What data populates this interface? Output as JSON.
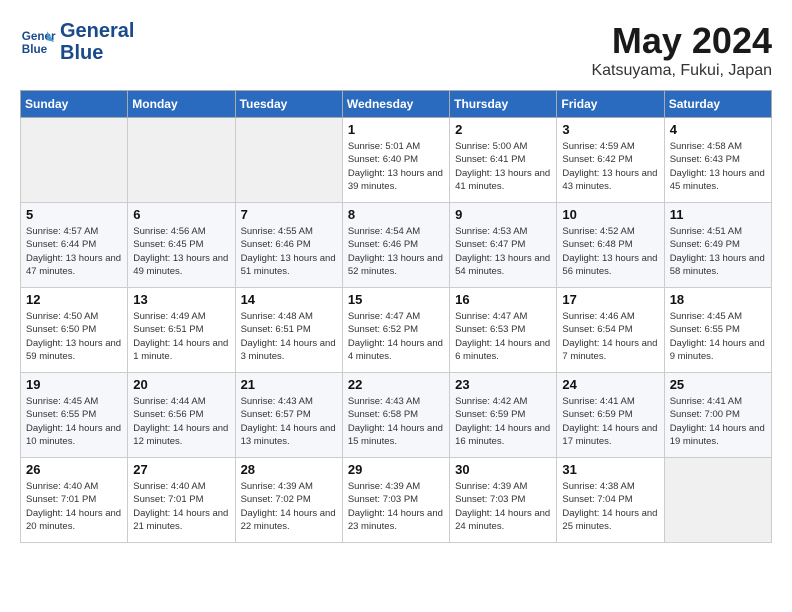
{
  "header": {
    "logo_line1": "General",
    "logo_line2": "Blue",
    "title": "May 2024",
    "subtitle": "Katsuyama, Fukui, Japan"
  },
  "weekdays": [
    "Sunday",
    "Monday",
    "Tuesday",
    "Wednesday",
    "Thursday",
    "Friday",
    "Saturday"
  ],
  "weeks": [
    [
      {
        "day": "",
        "sunrise": "",
        "sunset": "",
        "daylight": ""
      },
      {
        "day": "",
        "sunrise": "",
        "sunset": "",
        "daylight": ""
      },
      {
        "day": "",
        "sunrise": "",
        "sunset": "",
        "daylight": ""
      },
      {
        "day": "1",
        "sunrise": "Sunrise: 5:01 AM",
        "sunset": "Sunset: 6:40 PM",
        "daylight": "Daylight: 13 hours and 39 minutes."
      },
      {
        "day": "2",
        "sunrise": "Sunrise: 5:00 AM",
        "sunset": "Sunset: 6:41 PM",
        "daylight": "Daylight: 13 hours and 41 minutes."
      },
      {
        "day": "3",
        "sunrise": "Sunrise: 4:59 AM",
        "sunset": "Sunset: 6:42 PM",
        "daylight": "Daylight: 13 hours and 43 minutes."
      },
      {
        "day": "4",
        "sunrise": "Sunrise: 4:58 AM",
        "sunset": "Sunset: 6:43 PM",
        "daylight": "Daylight: 13 hours and 45 minutes."
      }
    ],
    [
      {
        "day": "5",
        "sunrise": "Sunrise: 4:57 AM",
        "sunset": "Sunset: 6:44 PM",
        "daylight": "Daylight: 13 hours and 47 minutes."
      },
      {
        "day": "6",
        "sunrise": "Sunrise: 4:56 AM",
        "sunset": "Sunset: 6:45 PM",
        "daylight": "Daylight: 13 hours and 49 minutes."
      },
      {
        "day": "7",
        "sunrise": "Sunrise: 4:55 AM",
        "sunset": "Sunset: 6:46 PM",
        "daylight": "Daylight: 13 hours and 51 minutes."
      },
      {
        "day": "8",
        "sunrise": "Sunrise: 4:54 AM",
        "sunset": "Sunset: 6:46 PM",
        "daylight": "Daylight: 13 hours and 52 minutes."
      },
      {
        "day": "9",
        "sunrise": "Sunrise: 4:53 AM",
        "sunset": "Sunset: 6:47 PM",
        "daylight": "Daylight: 13 hours and 54 minutes."
      },
      {
        "day": "10",
        "sunrise": "Sunrise: 4:52 AM",
        "sunset": "Sunset: 6:48 PM",
        "daylight": "Daylight: 13 hours and 56 minutes."
      },
      {
        "day": "11",
        "sunrise": "Sunrise: 4:51 AM",
        "sunset": "Sunset: 6:49 PM",
        "daylight": "Daylight: 13 hours and 58 minutes."
      }
    ],
    [
      {
        "day": "12",
        "sunrise": "Sunrise: 4:50 AM",
        "sunset": "Sunset: 6:50 PM",
        "daylight": "Daylight: 13 hours and 59 minutes."
      },
      {
        "day": "13",
        "sunrise": "Sunrise: 4:49 AM",
        "sunset": "Sunset: 6:51 PM",
        "daylight": "Daylight: 14 hours and 1 minute."
      },
      {
        "day": "14",
        "sunrise": "Sunrise: 4:48 AM",
        "sunset": "Sunset: 6:51 PM",
        "daylight": "Daylight: 14 hours and 3 minutes."
      },
      {
        "day": "15",
        "sunrise": "Sunrise: 4:47 AM",
        "sunset": "Sunset: 6:52 PM",
        "daylight": "Daylight: 14 hours and 4 minutes."
      },
      {
        "day": "16",
        "sunrise": "Sunrise: 4:47 AM",
        "sunset": "Sunset: 6:53 PM",
        "daylight": "Daylight: 14 hours and 6 minutes."
      },
      {
        "day": "17",
        "sunrise": "Sunrise: 4:46 AM",
        "sunset": "Sunset: 6:54 PM",
        "daylight": "Daylight: 14 hours and 7 minutes."
      },
      {
        "day": "18",
        "sunrise": "Sunrise: 4:45 AM",
        "sunset": "Sunset: 6:55 PM",
        "daylight": "Daylight: 14 hours and 9 minutes."
      }
    ],
    [
      {
        "day": "19",
        "sunrise": "Sunrise: 4:45 AM",
        "sunset": "Sunset: 6:55 PM",
        "daylight": "Daylight: 14 hours and 10 minutes."
      },
      {
        "day": "20",
        "sunrise": "Sunrise: 4:44 AM",
        "sunset": "Sunset: 6:56 PM",
        "daylight": "Daylight: 14 hours and 12 minutes."
      },
      {
        "day": "21",
        "sunrise": "Sunrise: 4:43 AM",
        "sunset": "Sunset: 6:57 PM",
        "daylight": "Daylight: 14 hours and 13 minutes."
      },
      {
        "day": "22",
        "sunrise": "Sunrise: 4:43 AM",
        "sunset": "Sunset: 6:58 PM",
        "daylight": "Daylight: 14 hours and 15 minutes."
      },
      {
        "day": "23",
        "sunrise": "Sunrise: 4:42 AM",
        "sunset": "Sunset: 6:59 PM",
        "daylight": "Daylight: 14 hours and 16 minutes."
      },
      {
        "day": "24",
        "sunrise": "Sunrise: 4:41 AM",
        "sunset": "Sunset: 6:59 PM",
        "daylight": "Daylight: 14 hours and 17 minutes."
      },
      {
        "day": "25",
        "sunrise": "Sunrise: 4:41 AM",
        "sunset": "Sunset: 7:00 PM",
        "daylight": "Daylight: 14 hours and 19 minutes."
      }
    ],
    [
      {
        "day": "26",
        "sunrise": "Sunrise: 4:40 AM",
        "sunset": "Sunset: 7:01 PM",
        "daylight": "Daylight: 14 hours and 20 minutes."
      },
      {
        "day": "27",
        "sunrise": "Sunrise: 4:40 AM",
        "sunset": "Sunset: 7:01 PM",
        "daylight": "Daylight: 14 hours and 21 minutes."
      },
      {
        "day": "28",
        "sunrise": "Sunrise: 4:39 AM",
        "sunset": "Sunset: 7:02 PM",
        "daylight": "Daylight: 14 hours and 22 minutes."
      },
      {
        "day": "29",
        "sunrise": "Sunrise: 4:39 AM",
        "sunset": "Sunset: 7:03 PM",
        "daylight": "Daylight: 14 hours and 23 minutes."
      },
      {
        "day": "30",
        "sunrise": "Sunrise: 4:39 AM",
        "sunset": "Sunset: 7:03 PM",
        "daylight": "Daylight: 14 hours and 24 minutes."
      },
      {
        "day": "31",
        "sunrise": "Sunrise: 4:38 AM",
        "sunset": "Sunset: 7:04 PM",
        "daylight": "Daylight: 14 hours and 25 minutes."
      },
      {
        "day": "",
        "sunrise": "",
        "sunset": "",
        "daylight": ""
      }
    ]
  ]
}
